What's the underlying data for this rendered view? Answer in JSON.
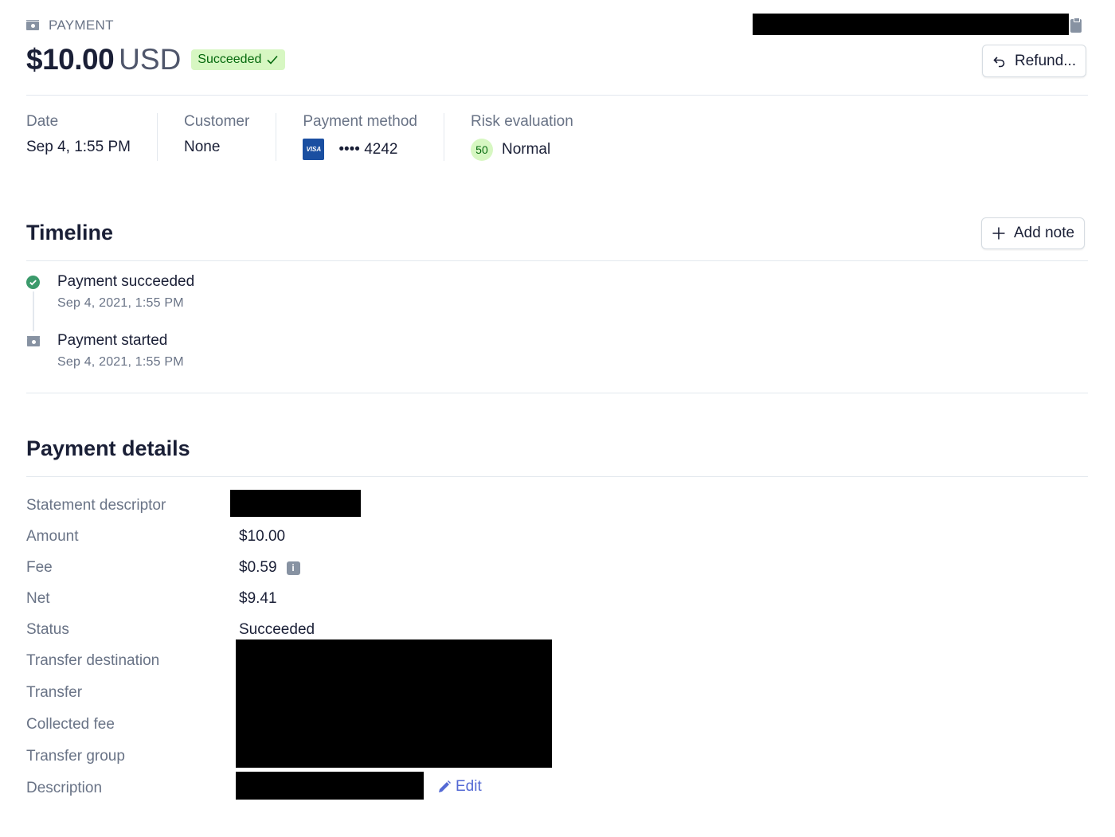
{
  "header": {
    "object_type": "PAYMENT",
    "amount": "$10.00",
    "currency": "USD",
    "status_badge": "Succeeded",
    "refund_button": "Refund..."
  },
  "summary": [
    {
      "label": "Date",
      "value": "Sep 4, 1:55 PM"
    },
    {
      "label": "Customer",
      "value": "None"
    },
    {
      "label": "Payment method",
      "card_brand": "VISA",
      "value": "•••• 4242"
    },
    {
      "label": "Risk evaluation",
      "score": "50",
      "value": "Normal"
    }
  ],
  "timeline": {
    "title": "Timeline",
    "add_note_button": "Add note",
    "events": [
      {
        "title": "Payment succeeded",
        "date": "Sep 4, 2021, 1:55 PM",
        "icon": "check-circle-icon"
      },
      {
        "title": "Payment started",
        "date": "Sep 4, 2021, 1:55 PM",
        "icon": "money-icon"
      }
    ]
  },
  "details": {
    "title": "Payment details",
    "rows": [
      {
        "label": "Statement descriptor",
        "value": ""
      },
      {
        "label": "Amount",
        "value": "$10.00"
      },
      {
        "label": "Fee",
        "value": "$0.59"
      },
      {
        "label": "Net",
        "value": "$9.41"
      },
      {
        "label": "Status",
        "value": "Succeeded"
      },
      {
        "label": "Transfer destination",
        "value": ""
      },
      {
        "label": "Transfer",
        "value": ""
      },
      {
        "label": "Collected fee",
        "value": ""
      },
      {
        "label": "Transfer group",
        "value": ""
      },
      {
        "label": "Description",
        "value": ""
      }
    ],
    "edit_link": "Edit"
  },
  "colors": {
    "success_bg": "#d7f7c2",
    "success_text": "#05690d",
    "link": "#5469d4",
    "visa_blue": "#1a4fa1"
  }
}
